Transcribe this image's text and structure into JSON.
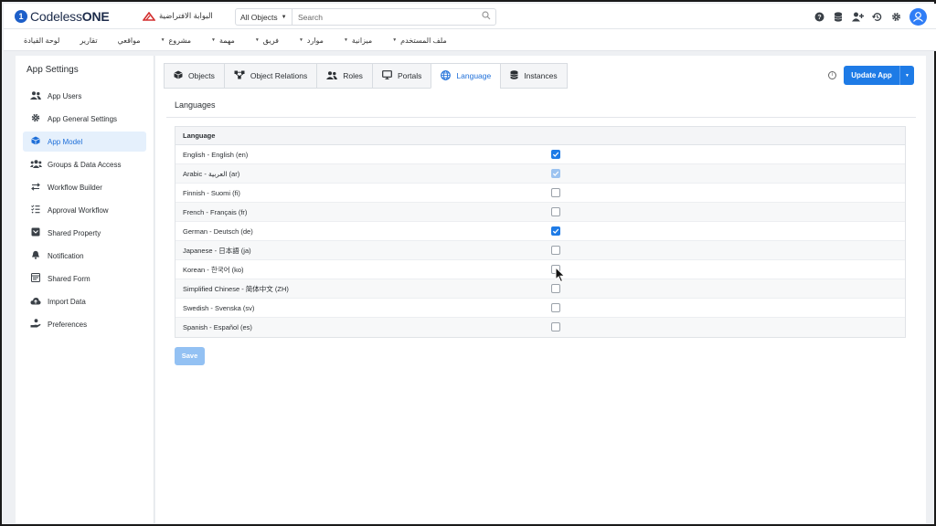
{
  "app": {
    "logo_mark": "1",
    "logo_text": "Codeless",
    "logo_text_bold": "ONE",
    "portal_name": "البوابة الافتراضية"
  },
  "search": {
    "scope": "All Objects",
    "placeholder": "Search"
  },
  "top_icons": [
    "help-icon",
    "database-icon",
    "add-user-icon",
    "history-icon",
    "gear-icon",
    "user-avatar-icon"
  ],
  "nav": {
    "items": [
      {
        "label": "ملف المستخدم",
        "has_dropdown": true
      },
      {
        "label": "ميزانية",
        "has_dropdown": true
      },
      {
        "label": "موارد",
        "has_dropdown": true
      },
      {
        "label": "فريق",
        "has_dropdown": true
      },
      {
        "label": "مهمة",
        "has_dropdown": true
      },
      {
        "label": "مشروع",
        "has_dropdown": true
      },
      {
        "label": "مواقعي",
        "has_dropdown": false
      },
      {
        "label": "تقارير",
        "has_dropdown": false
      },
      {
        "label": "لوحة القيادة",
        "has_dropdown": false
      }
    ]
  },
  "sidebar": {
    "title": "App Settings",
    "items": [
      {
        "label": "App Users",
        "icon": "users-icon",
        "active": false
      },
      {
        "label": "App General Settings",
        "icon": "gear-icon",
        "active": false
      },
      {
        "label": "App Model",
        "icon": "cube-icon",
        "active": true
      },
      {
        "label": "Groups & Data Access",
        "icon": "group-icon",
        "active": false
      },
      {
        "label": "Workflow Builder",
        "icon": "arrows-icon",
        "active": false
      },
      {
        "label": "Approval Workflow",
        "icon": "checklist-icon",
        "active": false
      },
      {
        "label": "Shared Property",
        "icon": "property-icon",
        "active": false
      },
      {
        "label": "Notification",
        "icon": "bell-icon",
        "active": false
      },
      {
        "label": "Shared Form",
        "icon": "form-icon",
        "active": false
      },
      {
        "label": "Import Data",
        "icon": "cloud-upload-icon",
        "active": false
      },
      {
        "label": "Preferences",
        "icon": "hand-user-icon",
        "active": false
      }
    ]
  },
  "tabs": [
    {
      "label": "Objects",
      "icon": "cube-icon",
      "active": false
    },
    {
      "label": "Object Relations",
      "icon": "relations-icon",
      "active": false
    },
    {
      "label": "Roles",
      "icon": "users-icon",
      "active": false
    },
    {
      "label": "Portals",
      "icon": "monitor-icon",
      "active": false
    },
    {
      "label": "Language",
      "icon": "globe-icon",
      "active": true
    },
    {
      "label": "Instances",
      "icon": "database-icon",
      "active": false
    }
  ],
  "actions": {
    "update_label": "Update App"
  },
  "languages": {
    "section_title": "Languages",
    "column_header": "Language",
    "rows": [
      {
        "label": "English - English (en)",
        "checked": true,
        "disabled": false
      },
      {
        "label": "Arabic - العربية (ar)",
        "checked": true,
        "disabled": true
      },
      {
        "label": "Finnish - Suomi (fi)",
        "checked": false,
        "disabled": false
      },
      {
        "label": "French - Français (fr)",
        "checked": false,
        "disabled": false
      },
      {
        "label": "German - Deutsch (de)",
        "checked": true,
        "disabled": false
      },
      {
        "label": "Japanese - 日本語 (ja)",
        "checked": false,
        "disabled": false
      },
      {
        "label": "Korean - 한국어 (ko)",
        "checked": false,
        "disabled": false
      },
      {
        "label": "Simplified Chinese - 简体中文 (ZH)",
        "checked": false,
        "disabled": false
      },
      {
        "label": "Swedish - Svenska (sv)",
        "checked": false,
        "disabled": false
      },
      {
        "label": "Spanish - Español (es)",
        "checked": false,
        "disabled": false
      }
    ],
    "save_label": "Save"
  },
  "colors": {
    "accent": "#1e7be6",
    "active_bg": "#e5f0fc",
    "save_disabled": "#93c1f3",
    "portal_mark": "#d32f2f"
  }
}
